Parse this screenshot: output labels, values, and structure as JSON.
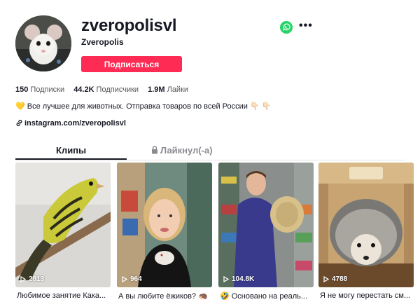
{
  "profile": {
    "username": "zveropolisvl",
    "nickname": "Zveropolis",
    "follow_label": "Подписаться"
  },
  "stats": [
    {
      "value": "150",
      "label": "Подписки"
    },
    {
      "value": "44.2K",
      "label": "Подписчики"
    },
    {
      "value": "1.9M",
      "label": "Лайки"
    }
  ],
  "bio": {
    "text": "Все лучшее для животных. Отправка товаров по всей России",
    "leading_emoji": "💛",
    "trailing_emoji": "👇🏻 👇🏻"
  },
  "link": {
    "text": "instagram.com/zveropolisvl"
  },
  "tabs": {
    "videos": "Клипы",
    "liked": "Лайкнул(-а)"
  },
  "videos": [
    {
      "plays": "2813",
      "caption": "Любимое занятие Кака..."
    },
    {
      "plays": "964",
      "caption": "А вы любите ёжиков? 🦔"
    },
    {
      "plays": "104.8K",
      "caption": "🤣 Основано на реаль..."
    },
    {
      "plays": "4788",
      "caption": "Я не могу перестать см..."
    }
  ],
  "colors": {
    "accent": "#fe2c55",
    "whatsapp": "#25d366"
  },
  "icons": {
    "whatsapp": "whatsapp-icon",
    "more": "more-icon",
    "link": "link-icon",
    "lock": "lock-icon",
    "play": "play-icon"
  }
}
